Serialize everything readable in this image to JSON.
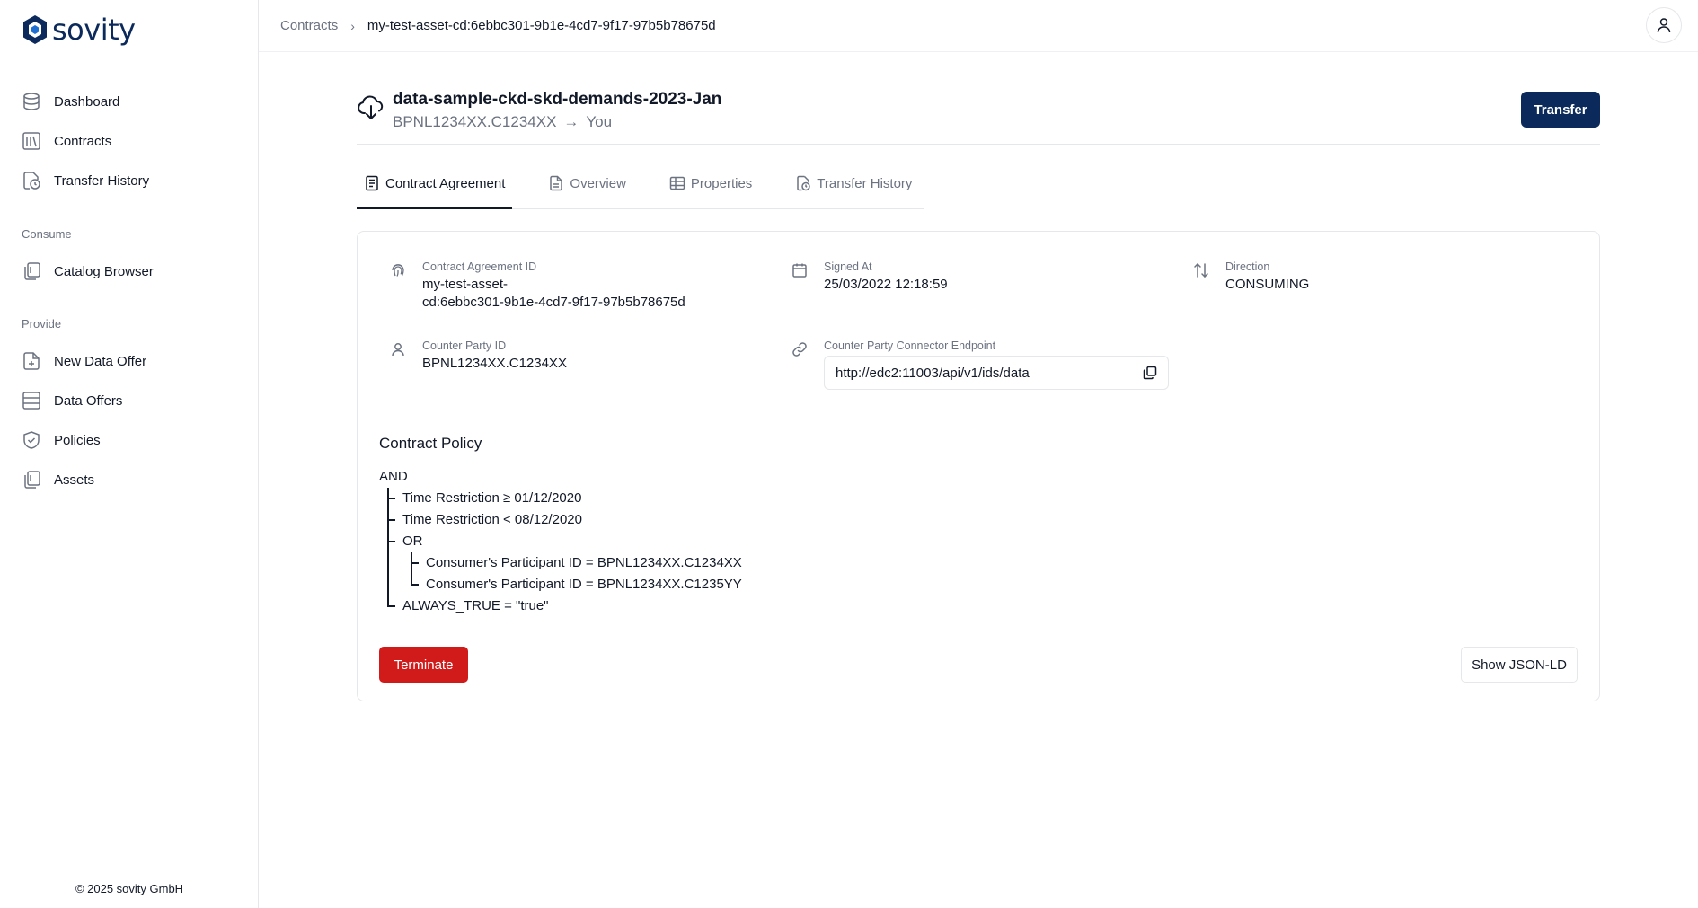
{
  "brand": {
    "logo_text": "sovity"
  },
  "sidebar": {
    "items": [
      {
        "label": "Dashboard",
        "icon": "dashboard-icon"
      },
      {
        "label": "Contracts",
        "icon": "contracts-icon"
      },
      {
        "label": "Transfer History",
        "icon": "transfer-history-icon"
      }
    ],
    "consume_label": "Consume",
    "consume_items": [
      {
        "label": "Catalog Browser",
        "icon": "catalog-icon"
      }
    ],
    "provide_label": "Provide",
    "provide_items": [
      {
        "label": "New Data Offer",
        "icon": "new-offer-icon"
      },
      {
        "label": "Data Offers",
        "icon": "data-offers-icon"
      },
      {
        "label": "Policies",
        "icon": "shield-icon"
      },
      {
        "label": "Assets",
        "icon": "assets-icon"
      }
    ],
    "footer": "© 2025 sovity GmbH"
  },
  "breadcrumb": {
    "parent": "Contracts",
    "current": "my-test-asset-cd:6ebbc301-9b1e-4cd7-9f17-97b5b78675d"
  },
  "header": {
    "title": "data-sample-ckd-skd-demands-2023-Jan",
    "from": "BPNL1234XX.C1234XX",
    "arrow": "→",
    "to": "You",
    "transfer_label": "Transfer"
  },
  "tabs": [
    {
      "label": "Contract Agreement",
      "icon": "document-icon",
      "active": true
    },
    {
      "label": "Overview",
      "icon": "file-icon",
      "active": false
    },
    {
      "label": "Properties",
      "icon": "table-icon",
      "active": false
    },
    {
      "label": "Transfer History",
      "icon": "history-icon",
      "active": false
    }
  ],
  "details": {
    "agreement_id_label": "Contract Agreement ID",
    "agreement_id_line1": "my-test-asset-",
    "agreement_id_line2": "cd:6ebbc301-9b1e-4cd7-9f17-97b5b78675d",
    "signed_at_label": "Signed At",
    "signed_at": "25/03/2022 12:18:59",
    "direction_label": "Direction",
    "direction": "CONSUMING",
    "counter_party_label": "Counter Party ID",
    "counter_party": "BPNL1234XX.C1234XX",
    "endpoint_label": "Counter Party Connector Endpoint",
    "endpoint": "http://edc2:11003/api/v1/ids/data"
  },
  "policy": {
    "title": "Contract Policy",
    "root": "AND",
    "rows": [
      "Time Restriction ≥ 01/12/2020",
      "Time Restriction < 08/12/2020",
      "OR",
      "Consumer's Participant ID = BPNL1234XX.C1234XX",
      "Consumer's Participant ID = BPNL1234XX.C1235YY",
      "ALWAYS_TRUE = \"true\""
    ]
  },
  "actions": {
    "terminate": "Terminate",
    "show_json": "Show JSON-LD"
  },
  "colors": {
    "brand": "#0b2a5b",
    "danger": "#d11a1a",
    "muted": "#6b7280"
  }
}
